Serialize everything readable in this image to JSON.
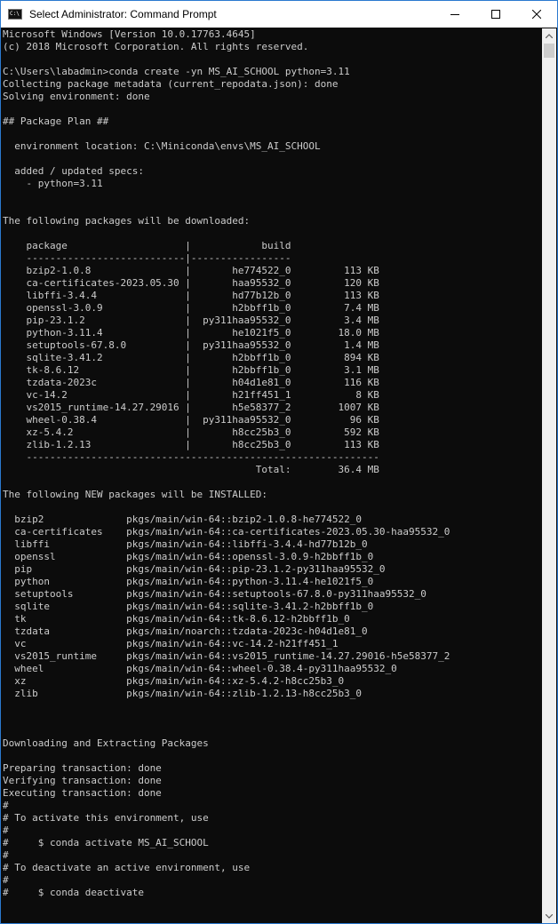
{
  "window": {
    "title": "Select Administrator: Command Prompt",
    "icon_name": "cmd-icon",
    "icon_text": "C:\\",
    "accent_border": "#2b79d0"
  },
  "terminal": {
    "background": "#0c0c0c",
    "foreground": "#cccccc",
    "lines": [
      "Microsoft Windows [Version 10.0.17763.4645]",
      "(c) 2018 Microsoft Corporation. All rights reserved.",
      "",
      "C:\\Users\\labadmin>conda create -yn MS_AI_SCHOOL python=3.11",
      "Collecting package metadata (current_repodata.json): done",
      "Solving environment: done",
      "",
      "## Package Plan ##",
      "",
      "  environment location: C:\\Miniconda\\envs\\MS_AI_SCHOOL",
      "",
      "  added / updated specs:",
      "    - python=3.11",
      "",
      "",
      "The following packages will be downloaded:",
      "",
      "    package                    |            build",
      "    ---------------------------|-----------------",
      "    bzip2-1.0.8                |       he774522_0         113 KB",
      "    ca-certificates-2023.05.30 |       haa95532_0         120 KB",
      "    libffi-3.4.4               |       hd77b12b_0         113 KB",
      "    openssl-3.0.9              |       h2bbff1b_0         7.4 MB",
      "    pip-23.1.2                 |  py311haa95532_0         3.4 MB",
      "    python-3.11.4              |       he1021f5_0        18.0 MB",
      "    setuptools-67.8.0          |  py311haa95532_0         1.4 MB",
      "    sqlite-3.41.2              |       h2bbff1b_0         894 KB",
      "    tk-8.6.12                  |       h2bbff1b_0         3.1 MB",
      "    tzdata-2023c               |       h04d1e81_0         116 KB",
      "    vc-14.2                    |       h21ff451_1           8 KB",
      "    vs2015_runtime-14.27.29016 |       h5e58377_2        1007 KB",
      "    wheel-0.38.4               |  py311haa95532_0          96 KB",
      "    xz-5.4.2                   |       h8cc25b3_0         592 KB",
      "    zlib-1.2.13                |       h8cc25b3_0         113 KB",
      "    ------------------------------------------------------------",
      "                                           Total:        36.4 MB",
      "",
      "The following NEW packages will be INSTALLED:",
      "",
      "  bzip2              pkgs/main/win-64::bzip2-1.0.8-he774522_0",
      "  ca-certificates    pkgs/main/win-64::ca-certificates-2023.05.30-haa95532_0",
      "  libffi             pkgs/main/win-64::libffi-3.4.4-hd77b12b_0",
      "  openssl            pkgs/main/win-64::openssl-3.0.9-h2bbff1b_0",
      "  pip                pkgs/main/win-64::pip-23.1.2-py311haa95532_0",
      "  python             pkgs/main/win-64::python-3.11.4-he1021f5_0",
      "  setuptools         pkgs/main/win-64::setuptools-67.8.0-py311haa95532_0",
      "  sqlite             pkgs/main/win-64::sqlite-3.41.2-h2bbff1b_0",
      "  tk                 pkgs/main/win-64::tk-8.6.12-h2bbff1b_0",
      "  tzdata             pkgs/main/noarch::tzdata-2023c-h04d1e81_0",
      "  vc                 pkgs/main/win-64::vc-14.2-h21ff451_1",
      "  vs2015_runtime     pkgs/main/win-64::vs2015_runtime-14.27.29016-h5e58377_2",
      "  wheel              pkgs/main/win-64::wheel-0.38.4-py311haa95532_0",
      "  xz                 pkgs/main/win-64::xz-5.4.2-h8cc25b3_0",
      "  zlib               pkgs/main/win-64::zlib-1.2.13-h8cc25b3_0",
      "",
      "",
      "",
      "Downloading and Extracting Packages",
      "",
      "Preparing transaction: done",
      "Verifying transaction: done",
      "Executing transaction: done",
      "#",
      "# To activate this environment, use",
      "#",
      "#     $ conda activate MS_AI_SCHOOL",
      "#",
      "# To deactivate an active environment, use",
      "#",
      "#     $ conda deactivate"
    ]
  }
}
